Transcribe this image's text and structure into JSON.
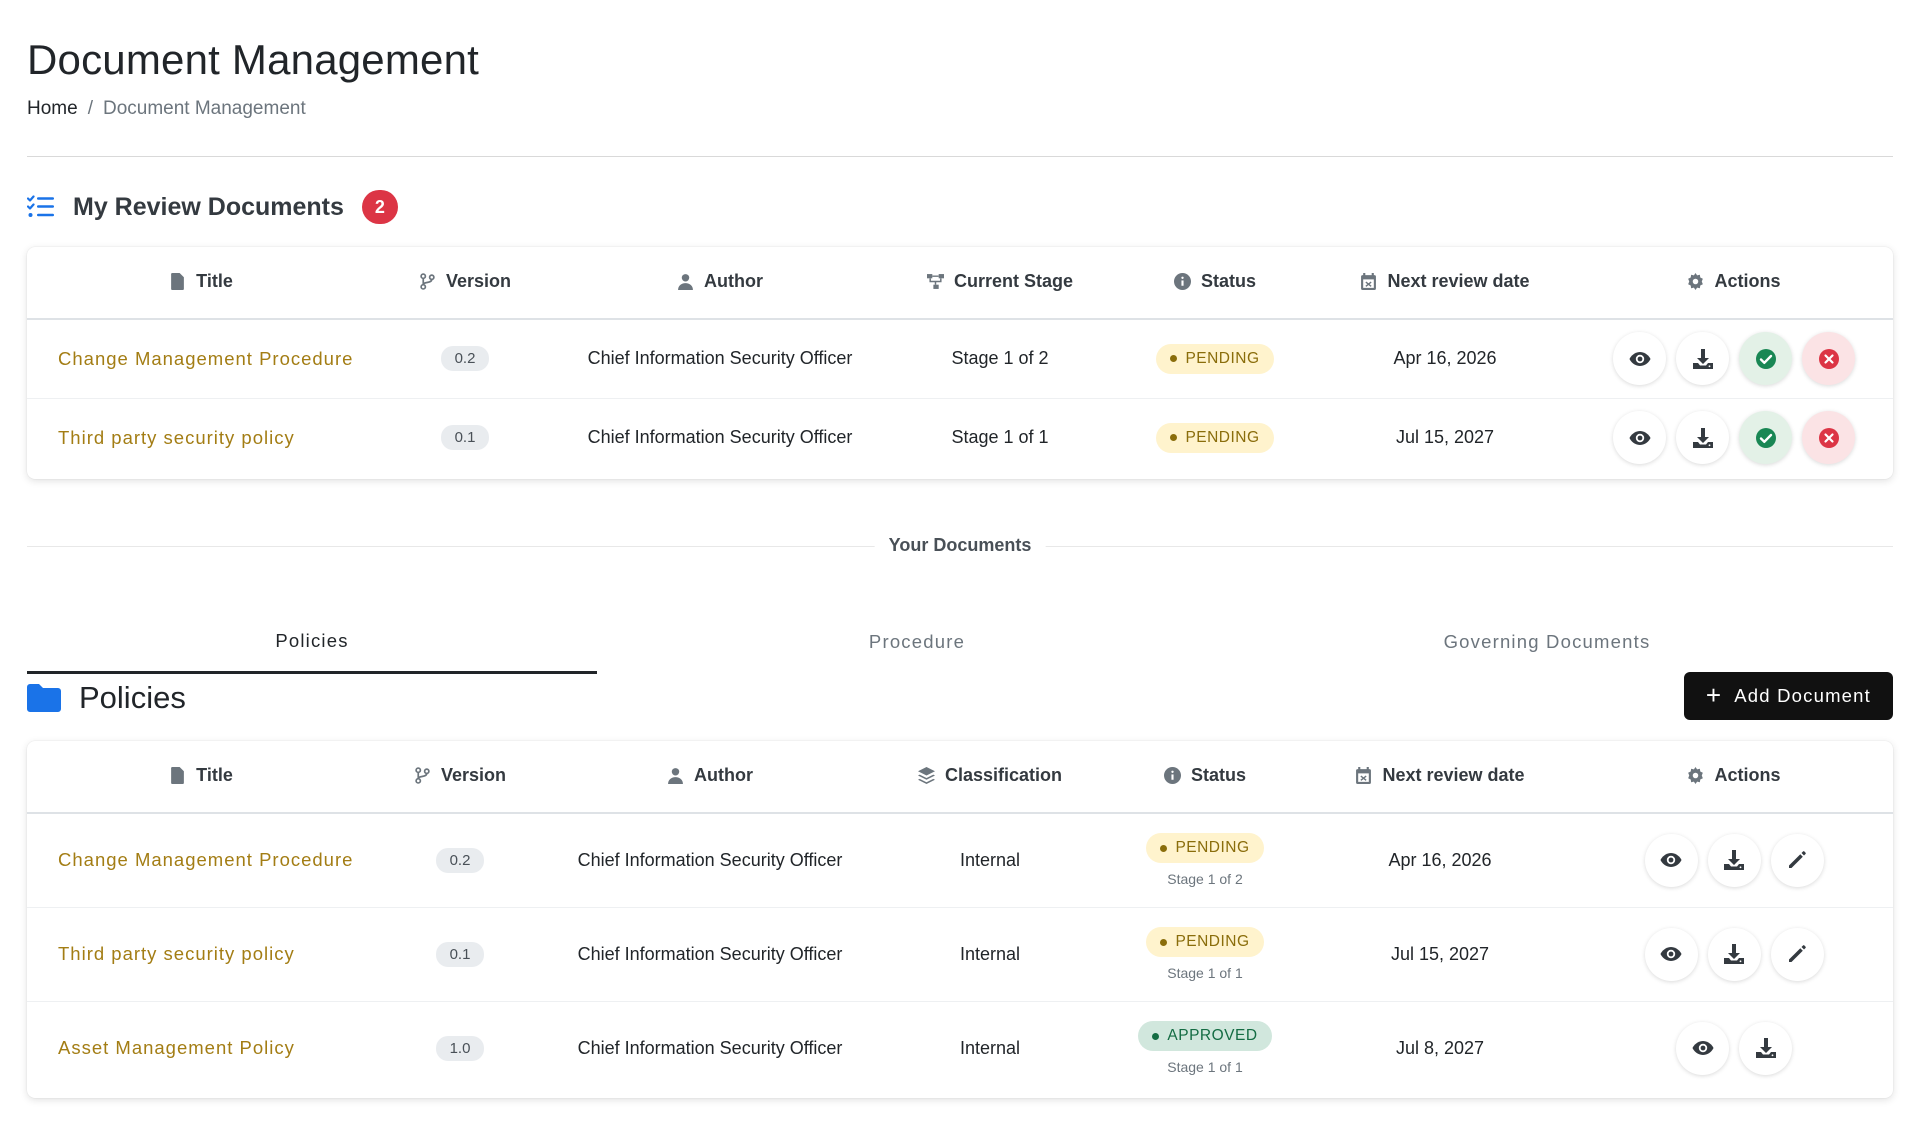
{
  "page": {
    "title": "Document Management",
    "breadcrumb": {
      "home": "Home",
      "separator": "/",
      "current": "Document Management"
    }
  },
  "review": {
    "heading": "My Review Documents",
    "count": "2",
    "columns": [
      "Title",
      "Version",
      "Author",
      "Current Stage",
      "Status",
      "Next review date",
      "Actions"
    ],
    "rows": [
      {
        "title": "Change Management Procedure",
        "version": "0.2",
        "author": "Chief Information Security Officer",
        "stage": "Stage 1 of 2",
        "status": "PENDING",
        "next_review": "Apr 16, 2026"
      },
      {
        "title": "Third party security policy",
        "version": "0.1",
        "author": "Chief Information Security Officer",
        "stage": "Stage 1 of 1",
        "status": "PENDING",
        "next_review": "Jul 15, 2027"
      }
    ]
  },
  "divider_label": "Your Documents",
  "tabs": [
    "Policies",
    "Procedure",
    "Governing Documents"
  ],
  "active_tab": "Policies",
  "policies": {
    "heading": "Policies",
    "add_button": "Add Document",
    "columns": [
      "Title",
      "Version",
      "Author",
      "Classification",
      "Status",
      "Next review date",
      "Actions"
    ],
    "rows": [
      {
        "title": "Change Management Procedure",
        "version": "0.2",
        "author": "Chief Information Security Officer",
        "classification": "Internal",
        "status": "PENDING",
        "stage": "Stage 1 of 2",
        "next_review": "Apr 16, 2026"
      },
      {
        "title": "Third party security policy",
        "version": "0.1",
        "author": "Chief Information Security Officer",
        "classification": "Internal",
        "status": "PENDING",
        "stage": "Stage 1 of 1",
        "next_review": "Jul 15, 2027"
      },
      {
        "title": "Asset Management Policy",
        "version": "1.0",
        "author": "Chief Information Security Officer",
        "classification": "Internal",
        "status": "APPROVED",
        "stage": "Stage 1 of 1",
        "next_review": "Jul 8, 2027"
      }
    ]
  },
  "colors": {
    "accent": "#a37d14",
    "badge": "#dc3545",
    "primary_blue": "#1a73e8",
    "pending_bg": "#fff3cd",
    "approved_bg": "#d1e7dd"
  },
  "icons": [
    "list-check-icon",
    "file-icon",
    "branch-icon",
    "user-icon",
    "sitemap-icon",
    "info-icon",
    "calendar-icon",
    "gear-icon",
    "layers-icon",
    "folder-icon",
    "eye-icon",
    "download-icon",
    "check-circle-icon",
    "x-circle-icon",
    "pencil-icon",
    "plus-icon"
  ]
}
